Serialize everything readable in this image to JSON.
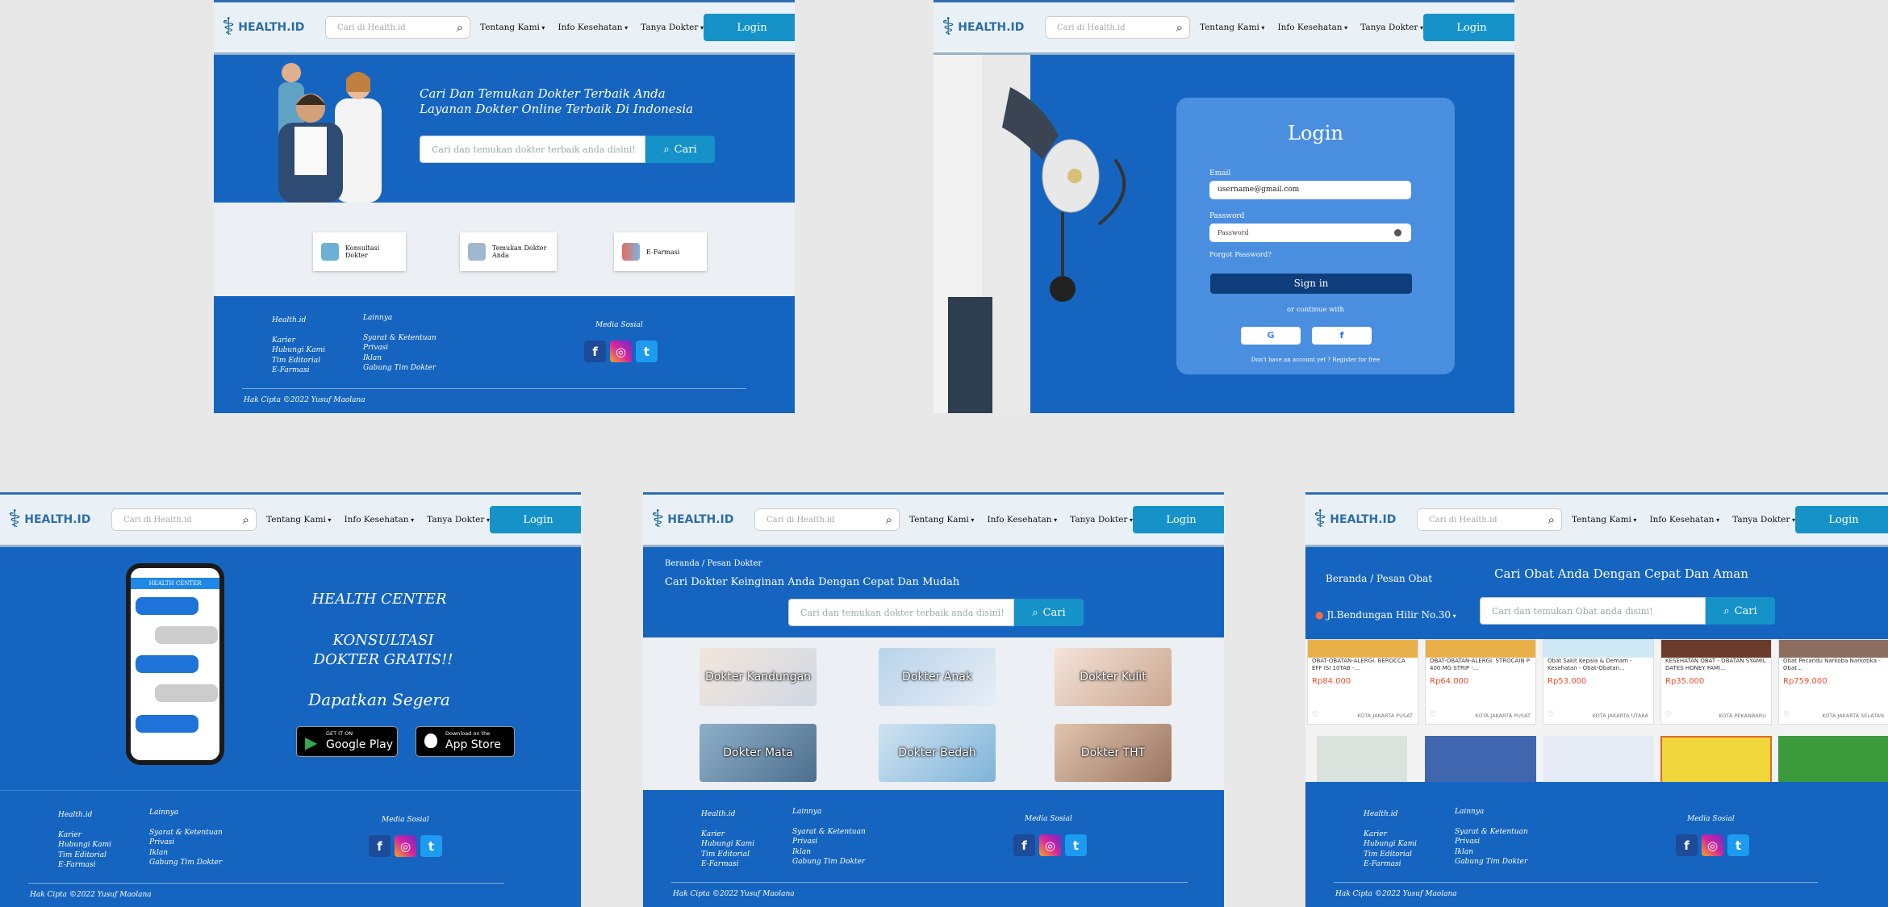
{
  "nav": {
    "logo_text": "HEALTH.ID",
    "search_placeholder": "Cari di Health.id",
    "menu": [
      "Tentang Kami",
      "Info Kesehatan",
      "Tanya Dokter"
    ],
    "login_label": "Login"
  },
  "footer": {
    "col1": [
      "Health.id",
      "Karier",
      "Hubungi Kami",
      "Tim Editorial",
      "E-Farmasi"
    ],
    "col2": [
      "Lainnya",
      "Syarat & Ketentuan",
      "Privasi",
      "Iklan",
      "Gabung Tim Dokter"
    ],
    "media_title": "Media Sosial",
    "copyright": "Hak Cipta ©2022 Yusuf Maolana"
  },
  "home": {
    "hero_line1": "Cari Dan Temukan Dokter Terbaik Anda",
    "hero_line2": "Layanan Dokter Online Terbaik Di Indonesia",
    "search_placeholder": "Cari dan temukan dokter terbaik anda disini!",
    "search_button": "Cari",
    "cards": [
      "Konsultasi Dokter",
      "Temukan Dokter Anda",
      "E-Farmasi"
    ]
  },
  "login": {
    "title": "Login",
    "email_label": "Email",
    "email_value": "username@gmail.com",
    "password_label": "Password",
    "password_placeholder": "Password",
    "forgot": "Forgot Password?",
    "sign_in": "Sign in",
    "continue_with": "or continue with",
    "register": "Don't have an account yet ?  Register for free"
  },
  "konsultasi": {
    "phone_header": "HEALTH CENTER",
    "title1": "HEALTH CENTER",
    "title2": "KONSULTASI DOKTER GRATIS!!",
    "title3": "Dapatkan Segera",
    "google_small": "GET IT ON",
    "google_big": "Google Play",
    "apple_small": "Download on the",
    "apple_big": "App Store"
  },
  "dokter": {
    "breadcrumb": "Beranda / Pesan Dokter",
    "heading": "Cari Dokter Keinginan Anda Dengan Cepat Dan Mudah",
    "search_placeholder": "Cari dan temukan dokter terbaik anda disini!",
    "search_button": "Cari",
    "categories": [
      "Dokter Kandungan",
      "Dokter Anak",
      "Dokter Kulit",
      "Dokter Mata",
      "Dokter Bedah",
      "Dokter THT"
    ]
  },
  "obat": {
    "breadcrumb": "Beranda / Pesan Obat",
    "heading": "Cari Obat Anda Dengan Cepat Dan Aman",
    "location": "Jl.Bendungan Hilir No.30",
    "search_placeholder": "Cari dan temukan Obat anda disini!",
    "search_button": "Cari",
    "products": [
      {
        "name": "OBAT-OBATAN-ALERGI. BEROCCA EFF ISI 10TAB -...",
        "price": "Rp84.000",
        "loc": "KOTA JAKARTA PUSAT"
      },
      {
        "name": "OBAT-OBATAN-ALERGI. STROCAIN P 400 MG STRIP -...",
        "price": "Rp64.000",
        "loc": "KOTA JAKARTA PUSAT"
      },
      {
        "name": "Obat Sakit Kepala & Demam - Kesehatan - Obat-Obatan...",
        "price": "Rp53.000",
        "loc": "KOTA JAKARTA UTARA"
      },
      {
        "name": "KESEHATAN OBAT - OBATAN SYAMIL DATES HONEY FAMI...",
        "price": "Rp35.000",
        "loc": "KOTA PEKANBARU"
      },
      {
        "name": "Obat Pecandu Narkoba Narkotika - Obat...",
        "price": "Rp759.000",
        "loc": "KOTA JAKARTA SELATAN"
      }
    ]
  }
}
